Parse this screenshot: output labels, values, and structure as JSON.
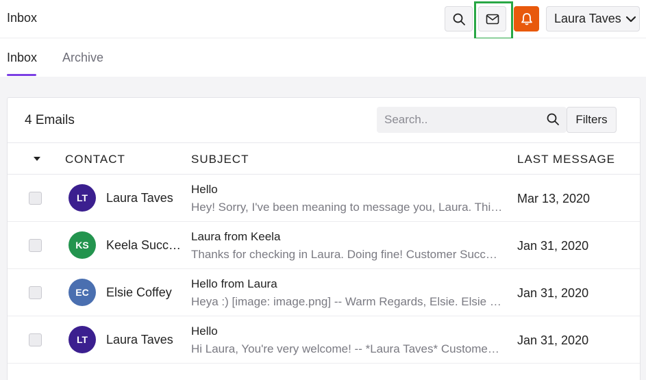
{
  "header": {
    "title": "Inbox",
    "user_name": "Laura Taves",
    "bell_color": "#e8590c",
    "highlight_color": "#28a745"
  },
  "tabs": [
    {
      "label": "Inbox",
      "active": true
    },
    {
      "label": "Archive",
      "active": false
    }
  ],
  "list": {
    "count_label": "4 Emails",
    "search_placeholder": "Search..",
    "filters_label": "Filters",
    "columns": {
      "contact": "CONTACT",
      "subject": "SUBJECT",
      "last_message": "LAST MESSAGE"
    },
    "rows": [
      {
        "initials": "LT",
        "avatar_color": "#3b1f8f",
        "name": "Laura Taves",
        "subject": "Hello",
        "preview": "Hey! Sorry, I've been meaning to message you, Laura. Thi…",
        "date": "Mar 13, 2020"
      },
      {
        "initials": "KS",
        "avatar_color": "#23944e",
        "name": "Keela Succ…",
        "subject": "Laura from Keela",
        "preview": "Thanks for checking in Laura. Doing fine! Customer Succ…",
        "date": "Jan 31, 2020"
      },
      {
        "initials": "EC",
        "avatar_color": "#4a6fb0",
        "name": "Elsie Coffey",
        "subject": "Hello from Laura",
        "preview": "Heya :) [image: image.png] -- Warm Regards, Elsie. Elsie …",
        "date": "Jan 31, 2020"
      },
      {
        "initials": "LT",
        "avatar_color": "#3b1f8f",
        "name": "Laura Taves",
        "subject": "Hello",
        "preview": "Hi Laura, You're very welcome! -- *Laura Taves* Custome…",
        "date": "Jan 31, 2020"
      }
    ]
  }
}
